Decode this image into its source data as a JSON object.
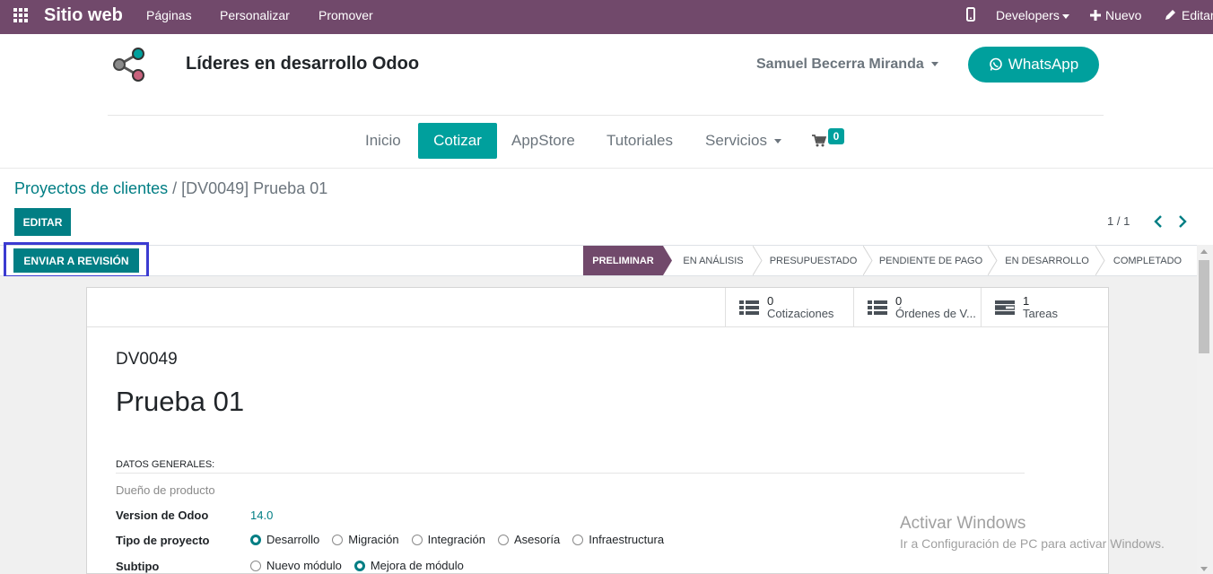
{
  "topbar": {
    "title": "Sitio web",
    "menus": [
      "Páginas",
      "Personalizar",
      "Promover"
    ],
    "developers": "Developers",
    "new": "Nuevo",
    "edit": "Editar"
  },
  "header": {
    "company": "Líderes en desarrollo Odoo",
    "user": "Samuel Becerra Miranda",
    "whatsapp": "WhatsApp",
    "nav": [
      "Inicio",
      "Cotizar",
      "AppStore",
      "Tutoriales",
      "Servicios"
    ],
    "cart_count": "0"
  },
  "breadcrumb": {
    "parent": "Proyectos de clientes",
    "sep": " / ",
    "current": "[DV0049] Prueba 01"
  },
  "controls": {
    "edit": "EDITAR",
    "pager": "1 / 1"
  },
  "statusbar": {
    "send_review": "ENVIAR A REVISIÓN",
    "stages": [
      "PRELIMINAR",
      "EN ANÁLISIS",
      "PRESUPUESTADO",
      "PENDIENTE DE PAGO",
      "EN DESARROLLO",
      "COMPLETADO"
    ],
    "active_stage": "PRELIMINAR"
  },
  "smart_buttons": [
    {
      "count": "0",
      "label": "Cotizaciones",
      "icon": "list-icon"
    },
    {
      "count": "0",
      "label": "Órdenes de V...",
      "icon": "list-icon"
    },
    {
      "count": "1",
      "label": "Tareas",
      "icon": "tasks-icon"
    }
  ],
  "form": {
    "ref": "DV0049",
    "name": "Prueba 01",
    "section": "DATOS GENERALES:",
    "owner_label": "Dueño de producto",
    "version_label": "Version de Odoo",
    "version_value": "14.0",
    "type_label": "Tipo de proyecto",
    "type_options": [
      "Desarrollo",
      "Migración",
      "Integración",
      "Asesoría",
      "Infraestructura"
    ],
    "type_selected": "Desarrollo",
    "subtype_label": "Subtipo",
    "subtype_options": [
      "Nuevo módulo",
      "Mejora de módulo"
    ],
    "subtype_selected": "Mejora de módulo"
  },
  "watermark": {
    "line1": "Activar Windows",
    "line2": "Ir a Configuración de PC para activar Windows."
  },
  "colors": {
    "topbar": "#71496b",
    "accent": "#00a09d",
    "primary": "#017e84",
    "highlight_border": "#3b3bd1"
  }
}
